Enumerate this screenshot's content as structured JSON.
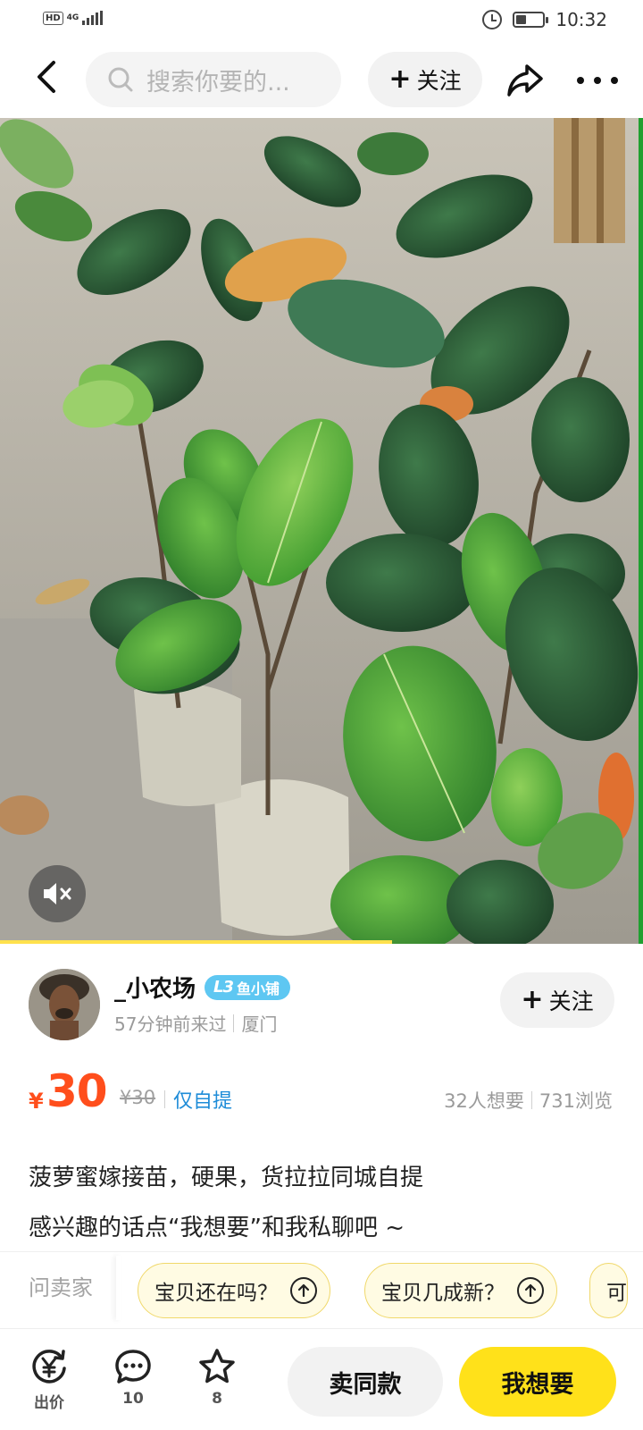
{
  "status_bar": {
    "hd_badge": "HD",
    "network": "4G",
    "time": "10:32",
    "battery_level_percent": 40,
    "icons": [
      "signal-icon",
      "alarm-icon",
      "battery-icon"
    ]
  },
  "nav": {
    "search_placeholder": "搜索你要的...",
    "follow_label": "关注",
    "icons": [
      "back-arrow-icon",
      "search-icon",
      "share-icon",
      "more-icon"
    ]
  },
  "media": {
    "type": "video",
    "description_icon": "mute-icon",
    "progress_fraction": 0.61
  },
  "seller": {
    "name": "_小农场",
    "level": "L3",
    "shop_type": "鱼小铺",
    "last_seen": "57分钟前来过",
    "location": "厦门",
    "follow_label": "关注"
  },
  "price": {
    "currency": "¥",
    "value": "30",
    "original": "¥30",
    "delivery": "仅自提",
    "wants": "32人想要",
    "views": "731浏览"
  },
  "description": {
    "line1": "菠萝蜜嫁接苗，硬果，货拉拉同城自提",
    "line2": "感兴趣的话点“我想要”和我私聊吧 ~"
  },
  "quick_questions": {
    "label": "问卖家",
    "items": [
      "宝贝还在吗？",
      "宝贝几成新？",
      "可"
    ]
  },
  "bottom_bar": {
    "offer_label": "出价",
    "comments_count": "10",
    "favorites_count": "8",
    "same_item_label": "卖同款",
    "want_label": "我想要"
  },
  "colors": {
    "price": "#ff4e1c",
    "accent_yellow": "#ffe11a",
    "link_blue": "#1e8cd8",
    "badge_blue": "#5ec7f2"
  }
}
